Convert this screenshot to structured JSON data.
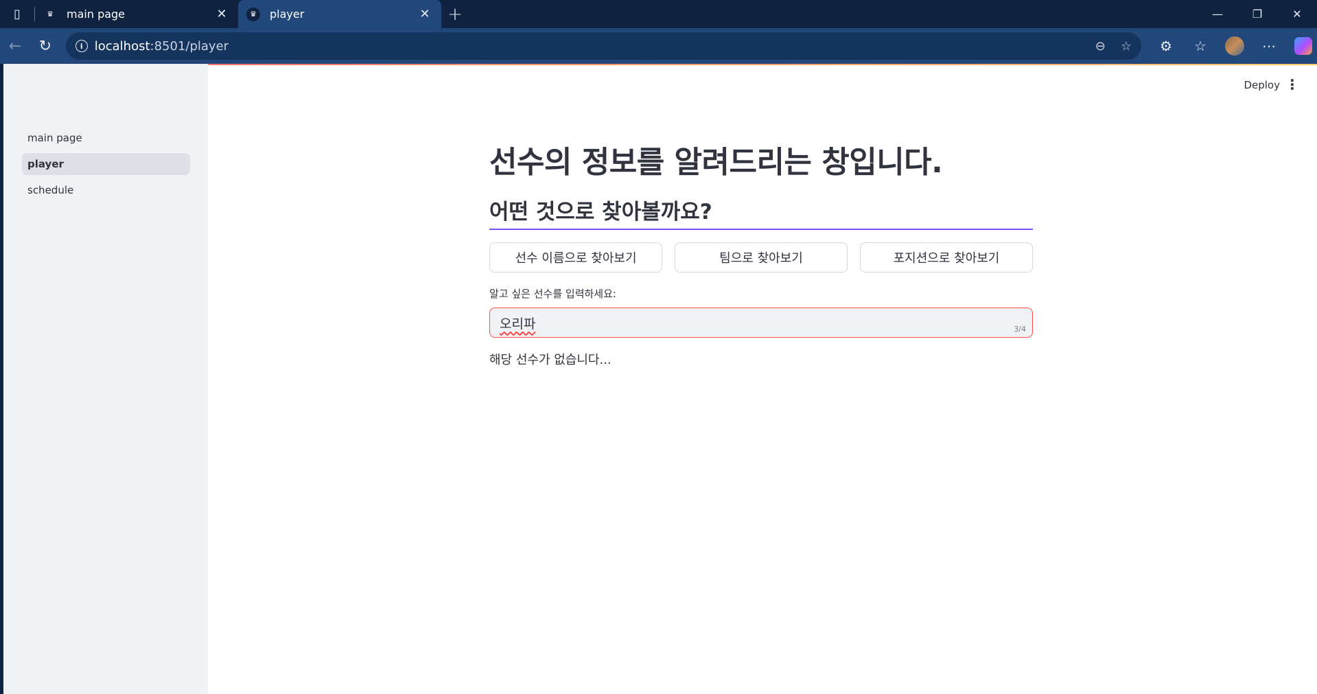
{
  "browser": {
    "tabs": [
      {
        "title": "main page",
        "active": false
      },
      {
        "title": "player",
        "active": true
      }
    ],
    "address": {
      "host": "localhost",
      "rest": ":8501/player"
    }
  },
  "app": {
    "deploy_label": "Deploy",
    "sidebar": {
      "items": [
        {
          "label": "main page",
          "active": false
        },
        {
          "label": "player",
          "active": true
        },
        {
          "label": "schedule",
          "active": false
        }
      ]
    },
    "main": {
      "title": "선수의 정보를 알려드리는 창입니다.",
      "subtitle": "어떤 것으로 찾아볼까요?",
      "buttons": [
        "선수 이름으로 찾아보기",
        "팀으로 찾아보기",
        "포지션으로 찾아보기"
      ],
      "input": {
        "label": "알고 싶은 선수를 입력하세요:",
        "value": "오리파",
        "counter": "3/4"
      },
      "result_text": "해당 선수가 없습니다..."
    }
  },
  "colors": {
    "accent": "#7c4dff",
    "error": "#ff4b4b",
    "chrome": "#0f2240",
    "toolbar": "#22477a"
  }
}
